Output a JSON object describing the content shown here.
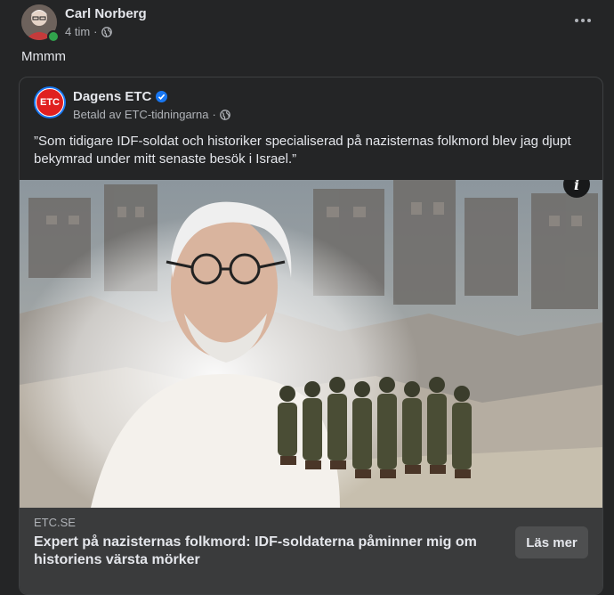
{
  "post": {
    "author": "Carl Norberg",
    "time": "4 tim",
    "separator": "·",
    "text": "Mmmm"
  },
  "ad": {
    "page_name": "Dagens ETC",
    "logo_text": "ETC",
    "paid_by": "Betald av ETC-tidningarna",
    "separator": "·",
    "quote": "”Som tidigare IDF-soldat och historiker specialiserad på nazisternas folkmord blev jag djupt bekymrad under mitt senaste besök i Israel.”",
    "info_label": "i",
    "link": {
      "domain": "ETC.SE",
      "title": "Expert på nazisternas folkmord: IDF-soldaterna påminner mig om historiens värsta mörker",
      "cta": "Läs mer"
    }
  },
  "colors": {
    "background": "#242526",
    "card_footer": "#3a3b3c",
    "verified": "#1877f2",
    "online": "#31a24c",
    "etc_red": "#e02020"
  }
}
